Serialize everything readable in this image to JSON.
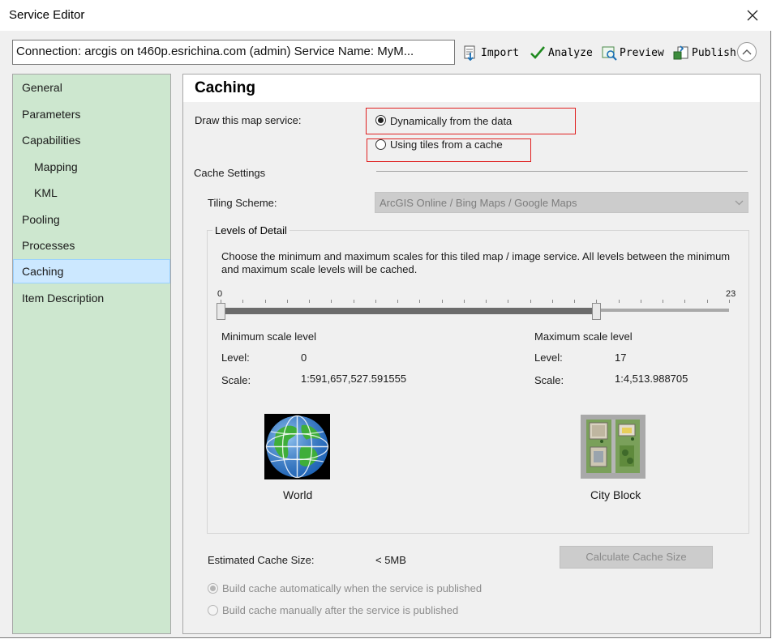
{
  "window": {
    "title": "Service Editor"
  },
  "toolbar": {
    "connection": "Connection: arcgis on t460p.esrichina.com (admin)   Service Name: MyM...",
    "import": "Import",
    "analyze": "Analyze",
    "preview": "Preview",
    "publish": "Publish"
  },
  "sidebar": {
    "items": [
      {
        "label": "General"
      },
      {
        "label": "Parameters"
      },
      {
        "label": "Capabilities"
      },
      {
        "label": "Mapping"
      },
      {
        "label": "KML"
      },
      {
        "label": "Pooling"
      },
      {
        "label": "Processes"
      },
      {
        "label": "Caching"
      },
      {
        "label": "Item Description"
      }
    ],
    "active": "Caching"
  },
  "caching": {
    "title": "Caching",
    "draw_label": "Draw this map service:",
    "option_dynamic": "Dynamically from the data",
    "option_tiles": "Using tiles from a cache",
    "selected_option": "Dynamically from the data",
    "cache_settings": "Cache Settings",
    "tiling_label": "Tiling Scheme:",
    "tiling_value": "ArcGIS Online / Bing Maps / Google Maps",
    "lod": {
      "legend": "Levels of Detail",
      "description": "Choose the minimum and maximum scales for this tiled map / image service. All levels between the minimum and maximum scale levels will be cached.",
      "slider_min_label": "0",
      "slider_max_label": "23",
      "slider_range": [
        0,
        23
      ],
      "selected_range": [
        0,
        17
      ],
      "min": {
        "heading": "Minimum scale level",
        "level_label": "Level:",
        "level": "0",
        "scale_label": "Scale:",
        "scale": "1:591,657,527.591555",
        "caption": "World"
      },
      "max": {
        "heading": "Maximum scale level",
        "level_label": "Level:",
        "level": "17",
        "scale_label": "Scale:",
        "scale": "1:4,513.988705",
        "caption": "City Block"
      }
    },
    "estimate_label": "Estimated Cache Size:",
    "estimate_value": "< 5MB",
    "calc_button": "Calculate Cache Size",
    "build_auto": "Build cache automatically when the service is published",
    "build_manual": "Build cache manually after the service is published"
  },
  "colors": {
    "sidebar_bg": "#cde7cf",
    "selected_bg": "#cce8ff",
    "highlight_box": "#e02020"
  }
}
